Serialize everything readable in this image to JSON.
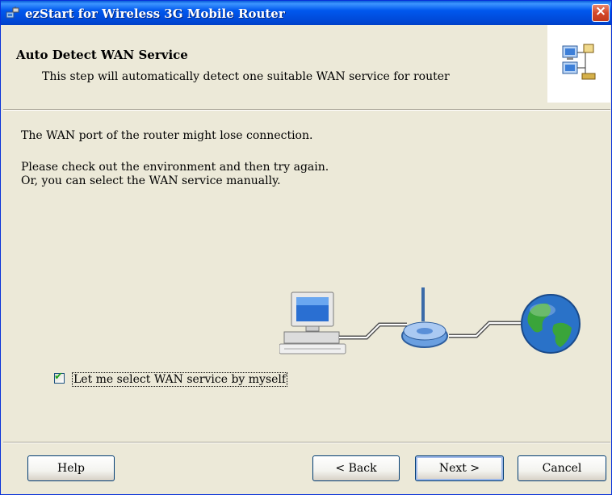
{
  "window": {
    "title": "ezStart for Wireless 3G Mobile Router",
    "close_glyph": "×"
  },
  "header": {
    "title": "Auto Detect WAN Service",
    "subtitle": "This step will automatically detect one suitable WAN service for router",
    "icon": "network-wizard-icon"
  },
  "body": {
    "line1": "The WAN port of the router might lose connection.",
    "line2": "Please check out the environment and then try again.",
    "line3": "Or, you can select the WAN service manually.",
    "illustration": [
      "computer-icon",
      "router-icon",
      "globe-icon"
    ]
  },
  "checkbox": {
    "label": "Let me select WAN service by myself",
    "checked": true,
    "glyph": "✔"
  },
  "buttons": {
    "help": "Help",
    "back": "< Back",
    "next": "Next >",
    "cancel": "Cancel"
  }
}
